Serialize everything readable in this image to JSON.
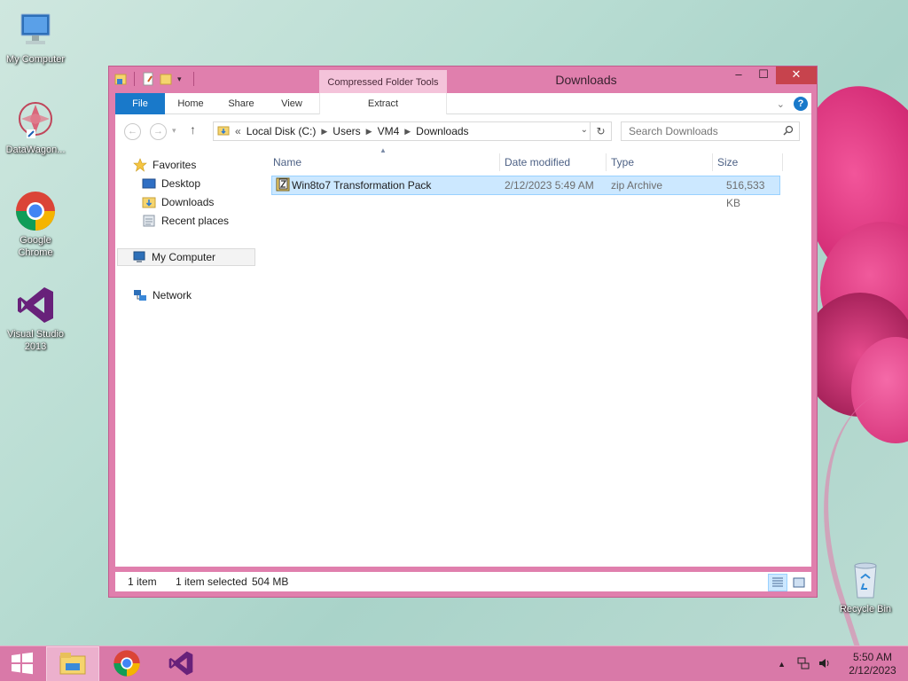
{
  "desktop": {
    "icons": [
      {
        "label": "My Computer"
      },
      {
        "label": "DataWagon..."
      },
      {
        "label": "Google Chrome"
      },
      {
        "label": "Visual Studio 2013"
      },
      {
        "label": "Recycle Bin"
      }
    ]
  },
  "window": {
    "title": "Downloads",
    "contextual_tab": "Compressed Folder Tools",
    "ribbon_tabs": [
      "File",
      "Home",
      "Share",
      "View"
    ],
    "contextual_subtab": "Extract",
    "controls": {
      "minimize": "–",
      "maximize": "☐",
      "close": "✕"
    },
    "help": "?"
  },
  "address_bar": {
    "prefix": "«",
    "segments": [
      "Local Disk (C:)",
      "Users",
      "VM4",
      "Downloads"
    ]
  },
  "search": {
    "placeholder": "Search Downloads"
  },
  "nav_pane": {
    "favorites": "Favorites",
    "favorites_items": [
      "Desktop",
      "Downloads",
      "Recent places"
    ],
    "my_computer": "My Computer",
    "network": "Network"
  },
  "file_list": {
    "columns": [
      "Name",
      "Date modified",
      "Type",
      "Size"
    ],
    "rows": [
      {
        "name": "Win8to7 Transformation Pack",
        "date": "2/12/2023 5:49 AM",
        "type": "zip Archive",
        "size": "516,533 KB"
      }
    ]
  },
  "status_bar": {
    "item_count": "1 item",
    "selection": "1 item selected",
    "selection_size": "504 MB"
  },
  "taskbar": {
    "time": "5:50 AM",
    "date": "2/12/2023"
  },
  "colors": {
    "window_frame": "#e07fad",
    "accent_blue": "#1979ca",
    "selection": "#cce8ff",
    "taskbar": "#d979a8"
  }
}
